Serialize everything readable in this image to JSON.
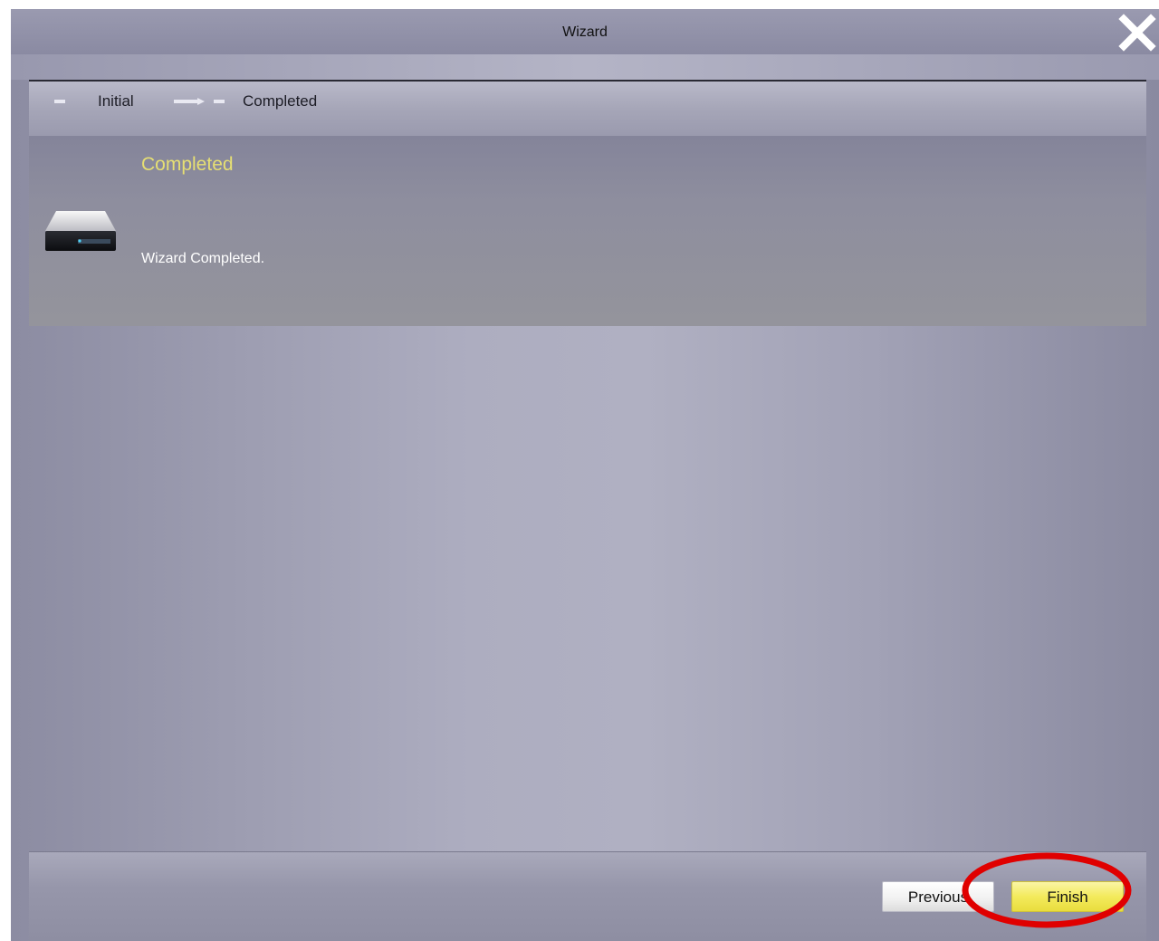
{
  "window": {
    "title": "Wizard"
  },
  "steps": {
    "items": [
      {
        "label": "Initial"
      },
      {
        "label": "Completed"
      }
    ]
  },
  "content": {
    "section_title": "Completed",
    "message": "Wizard Completed."
  },
  "footer": {
    "previous_label": "Previous",
    "finish_label": "Finish"
  },
  "icons": {
    "close": "close-icon",
    "drive": "hard-drive-icon",
    "step_arrow": "arrow-right-icon",
    "highlight": "red-ellipse-annotation"
  },
  "colors": {
    "section_title": "#e6df73",
    "finish_button": "#f3ea5c",
    "highlight_ring": "#e00000"
  }
}
